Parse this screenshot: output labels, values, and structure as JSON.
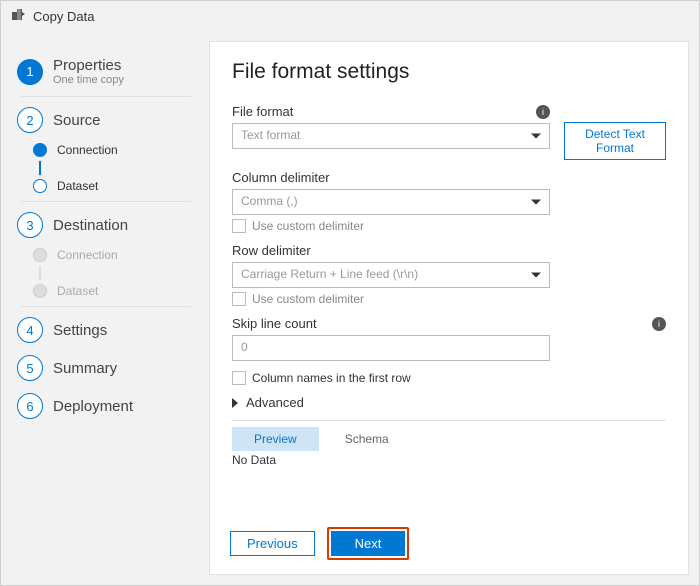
{
  "header": {
    "title": "Copy Data"
  },
  "sidebar": {
    "steps": [
      {
        "label": "Properties",
        "sublabel": "One time copy"
      },
      {
        "label": "Source",
        "children": [
          "Connection",
          "Dataset"
        ]
      },
      {
        "label": "Destination",
        "children": [
          "Connection",
          "Dataset"
        ]
      },
      {
        "label": "Settings"
      },
      {
        "label": "Summary"
      },
      {
        "label": "Deployment"
      }
    ]
  },
  "panel": {
    "title": "File format settings",
    "file_format": {
      "label": "File format",
      "value": "Text format",
      "detect_label": "Detect Text Format"
    },
    "col_delim": {
      "label": "Column delimiter",
      "value": "Comma (,)",
      "custom_label": "Use custom delimiter"
    },
    "row_delim": {
      "label": "Row delimiter",
      "value": "Carriage Return + Line feed (\\r\\n)",
      "custom_label": "Use custom delimiter"
    },
    "skip": {
      "label": "Skip line count",
      "value": "0"
    },
    "first_row": {
      "label": "Column names in the first row"
    },
    "advanced": {
      "label": "Advanced"
    },
    "tabs": {
      "preview": "Preview",
      "schema": "Schema"
    },
    "preview_empty": "No Data",
    "footer": {
      "previous": "Previous",
      "next": "Next"
    }
  }
}
